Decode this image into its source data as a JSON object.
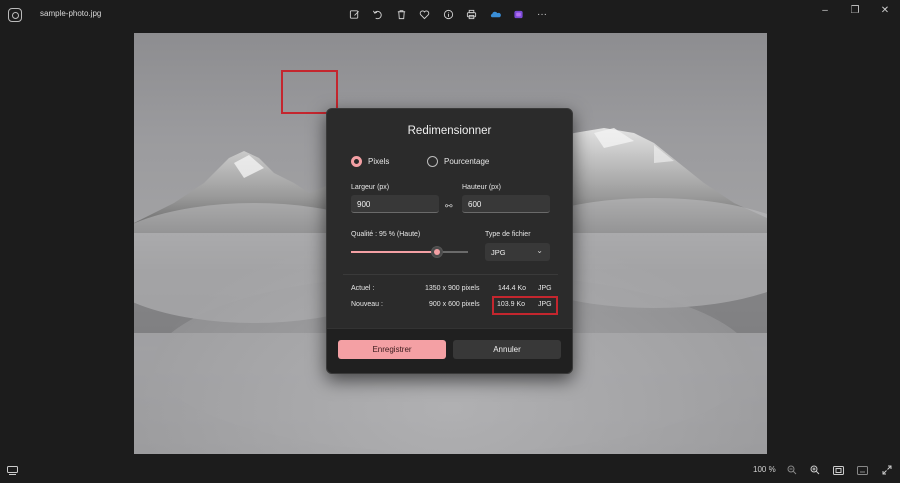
{
  "titlebar": {
    "filename": "sample-photo.jpg",
    "toolbar_icons": [
      "edit-icon",
      "rotate-icon",
      "delete-icon",
      "favorite-icon",
      "info-icon",
      "print-icon",
      "onedrive-icon",
      "clipchamp-icon",
      "more-icon"
    ],
    "more_label": "···"
  },
  "dialog": {
    "title": "Redimensionner",
    "radio_pixels": "Pixels",
    "radio_percent": "Pourcentage",
    "width_label": "Largeur (px)",
    "width_value": "900",
    "height_label": "Hauteur (px)",
    "height_value": "600",
    "quality_label": "Qualité : 95 % (Haute)",
    "quality_value": 95,
    "filetype_label": "Type de fichier",
    "filetype_value": "JPG",
    "current_label": "Actuel :",
    "current_dims": "1350 x 900 pixels",
    "current_size": "144.4 Ko",
    "current_type": "JPG",
    "new_label": "Nouveau :",
    "new_dims": "900 x 600 pixels",
    "new_size": "103.9 Ko",
    "new_type": "JPG",
    "save_label": "Enregistrer",
    "cancel_label": "Annuler"
  },
  "statusbar": {
    "zoom": "100 %"
  },
  "colors": {
    "accent": "#f4a0a4",
    "highlight": "#c4262e"
  }
}
